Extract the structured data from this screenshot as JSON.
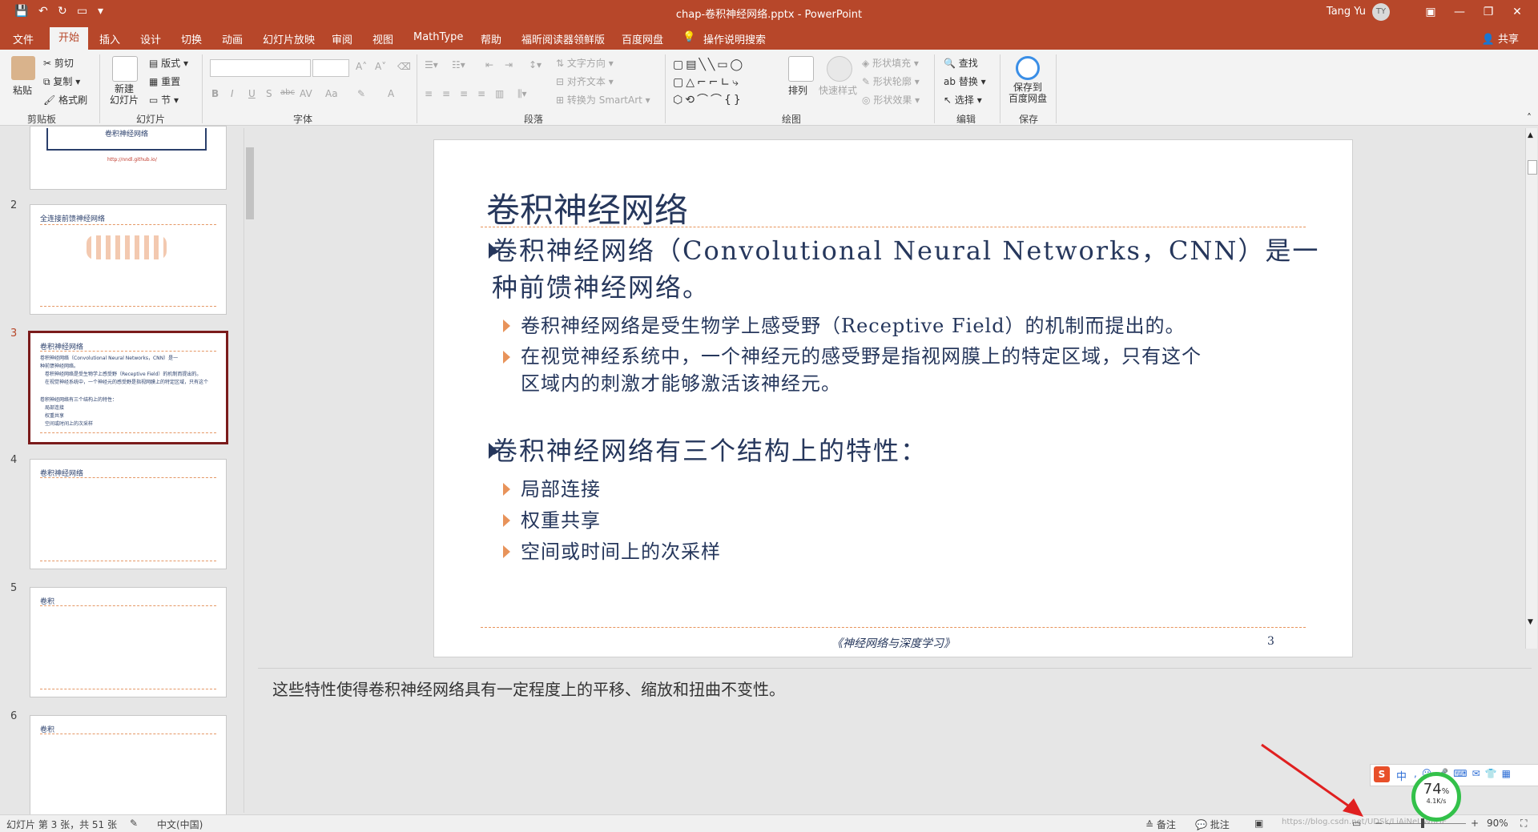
{
  "window": {
    "title": "chap-卷积神经网络.pptx  -  PowerPoint",
    "user": "Tang Yu",
    "user_initials": "TY"
  },
  "tabs": [
    "文件",
    "开始",
    "插入",
    "设计",
    "切换",
    "动画",
    "幻灯片放映",
    "审阅",
    "视图",
    "MathType",
    "帮助",
    "福昕阅读器领鲜版",
    "百度网盘",
    "操作说明搜索"
  ],
  "share": "共享",
  "ribbon": {
    "clipboard": {
      "paste": "粘贴",
      "cut": "剪切",
      "copy": "复制",
      "format_painter": "格式刷",
      "label": "剪贴板"
    },
    "slides": {
      "new_slide": "新建\n幻灯片",
      "layout": "版式",
      "reset": "重置",
      "section": "节",
      "label": "幻灯片"
    },
    "font": {
      "label": "字体",
      "bold": "B",
      "italic": "I",
      "underline": "U",
      "shadow": "S",
      "strike": "abc",
      "spacing": "AV",
      "case": "Aa"
    },
    "paragraph": {
      "label": "段落",
      "text_direction": "文字方向",
      "align_text": "对齐文本",
      "smartart": "转换为 SmartArt"
    },
    "drawing": {
      "label": "绘图",
      "arrange": "排列",
      "quick_styles": "快速样式",
      "shape_fill": "形状填充",
      "shape_outline": "形状轮廓",
      "shape_effects": "形状效果"
    },
    "editing": {
      "label": "编辑",
      "find": "查找",
      "replace": "替换",
      "select": "选择"
    },
    "save": {
      "label": "保存",
      "save_baidu": "保存到\n百度网盘"
    }
  },
  "thumbnails": [
    {
      "num": "",
      "title": "卷积神经网络",
      "partial": true,
      "link": "http://nndl.github.io/"
    },
    {
      "num": "2",
      "title": "全连接前馈神经网络"
    },
    {
      "num": "3",
      "title": "卷积神经网络",
      "selected": true
    },
    {
      "num": "4",
      "title": "卷积神经网络"
    },
    {
      "num": "5",
      "title": "卷积"
    },
    {
      "num": "6",
      "title": "卷积"
    }
  ],
  "slide": {
    "title": "卷积神经网络",
    "bullets": [
      {
        "level": 1,
        "lines": [
          "卷积神经网络（Convolutional Neural Networks，CNN）是一",
          "种前馈神经网络。"
        ]
      },
      {
        "level": 2,
        "lines": [
          "卷积神经网络是受生物学上感受野（Receptive Field）的机制而提出的。"
        ]
      },
      {
        "level": 2,
        "lines": [
          "在视觉神经系统中，一个神经元的感受野是指视网膜上的特定区域，只有这个",
          "区域内的刺激才能够激活该神经元。"
        ]
      },
      {
        "level": 1,
        "lines": [
          "卷积神经网络有三个结构上的特性："
        ]
      },
      {
        "level": 2,
        "lines": [
          "局部连接"
        ]
      },
      {
        "level": 2,
        "lines": [
          "权重共享"
        ]
      },
      {
        "level": 2,
        "lines": [
          "空间或时间上的次采样"
        ]
      }
    ],
    "footer": "《神经网络与深度学习》",
    "page": "3"
  },
  "notes": "这些特性使得卷积神经网络具有一定程度上的平移、缩放和扭曲不变性。",
  "status": {
    "slide_info": "幻灯片 第 3 张，共 51 张",
    "language": "中文(中国)",
    "notes_btn": "备注",
    "comments_btn": "批注",
    "zoom": "90%",
    "watermark": "https://blog.csdn.net/UDSk/LiAiNeUWuHE"
  },
  "overlay": {
    "ime_label": "中",
    "net_percent": "74",
    "net_speed": "4.1K/s"
  },
  "colors": {
    "accent": "#b7472a",
    "slide_text": "#26375c",
    "slide_accent": "#e8935a",
    "selected_thumb": "#7a1b1b"
  }
}
